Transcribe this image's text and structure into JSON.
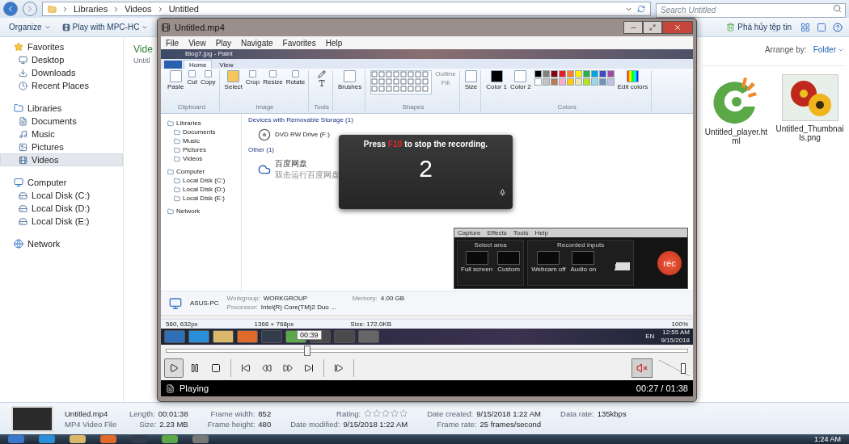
{
  "explorer": {
    "crumbs": [
      "Libraries",
      "Videos",
      "Untitled"
    ],
    "search": {
      "placeholder": "Search Untitled"
    },
    "toolbar": {
      "buttons": [
        "Organize",
        "Play with MPC-HC"
      ],
      "right_button": "Phá hủy tệp tin"
    },
    "sidebar": {
      "groups": [
        {
          "label": "Favorites",
          "children": [
            {
              "label": "Desktop",
              "selected": false
            },
            {
              "label": "Downloads",
              "selected": false
            },
            {
              "label": "Recent Places",
              "selected": false
            }
          ]
        },
        {
          "label": "Libraries",
          "children": [
            {
              "label": "Documents",
              "selected": false
            },
            {
              "label": "Music",
              "selected": false
            },
            {
              "label": "Pictures",
              "selected": false
            },
            {
              "label": "Videos",
              "selected": true
            }
          ]
        },
        {
          "label": "Computer",
          "children": [
            {
              "label": "Local Disk (C:)",
              "selected": false
            },
            {
              "label": "Local Disk (D:)",
              "selected": false
            },
            {
              "label": "Local Disk (E:)",
              "selected": false
            }
          ]
        },
        {
          "label": "Network"
        }
      ]
    },
    "heading": {
      "title": "Vide",
      "subtitle": "Untitl"
    },
    "arrange": {
      "label": "Arrange by:",
      "value": "Folder"
    },
    "files": [
      {
        "name": "Untitled_player.html",
        "kind": "web"
      },
      {
        "name": "Untitled_Thumbnails.png",
        "kind": "image"
      }
    ],
    "details": {
      "file_name": "Untitled.mp4",
      "file_type": "MP4 Video File",
      "stars": 0,
      "columns": [
        [
          {
            "kind": "text",
            "label": "Length:",
            "value": "00:01:38"
          },
          {
            "kind": "text",
            "label": "Size:",
            "value": "2.23 MB"
          }
        ],
        [
          {
            "kind": "text",
            "label": "Frame width:",
            "value": "852"
          },
          {
            "kind": "text",
            "label": "Frame height:",
            "value": "480"
          }
        ],
        [
          {
            "kind": "rating",
            "label": "Rating:"
          },
          {
            "kind": "text",
            "label": "Date modified:",
            "value": "9/15/2018 1:22 AM"
          }
        ],
        [
          {
            "kind": "text",
            "label": "Date created:",
            "value": "9/15/2018 1:22 AM"
          },
          {
            "kind": "text",
            "label": "Frame rate:",
            "value": "25 frames/second"
          }
        ],
        [
          {
            "kind": "text",
            "label": "Data rate:",
            "value": "135kbps"
          }
        ]
      ]
    }
  },
  "player": {
    "title": "Untitled.mp4",
    "menu": [
      "File",
      "View",
      "Play",
      "Navigate",
      "Favorites",
      "Help"
    ],
    "video": {
      "paint": {
        "title": "Blog7.jpg - Paint",
        "tabs": [
          {
            "label": "Home",
            "selected": true
          },
          {
            "label": "View",
            "selected": false
          }
        ],
        "groups": [
          {
            "kind": "buttons",
            "label": "Clipboard",
            "items": [
              "Paste",
              "Cut",
              "Copy"
            ]
          },
          {
            "kind": "buttons",
            "label": "Image",
            "items": [
              "Select",
              "Crop",
              "Resize",
              "Rotate"
            ]
          },
          {
            "kind": "tools",
            "label": "Tools"
          },
          {
            "kind": "buttons",
            "items": [
              "Brushes"
            ]
          },
          {
            "kind": "shapes",
            "label": "Shapes",
            "items": [
              "Outline",
              "Fill"
            ]
          },
          {
            "kind": "buttons",
            "items": [
              "Size"
            ]
          },
          {
            "kind": "colors",
            "label": "Colors",
            "items": [
              "Color 1",
              "Color 2",
              "Edit colors"
            ]
          }
        ],
        "palette": [
          {
            "color": "#000000"
          },
          {
            "color": "#7f7f7f"
          },
          {
            "color": "#880015"
          },
          {
            "color": "#ed1c24"
          },
          {
            "color": "#ff7f27"
          },
          {
            "color": "#fff200"
          },
          {
            "color": "#22b14c"
          },
          {
            "color": "#00a2e8"
          },
          {
            "color": "#3f48cc"
          },
          {
            "color": "#a349a4"
          },
          {
            "color": "#ffffff"
          },
          {
            "color": "#c3c3c3"
          },
          {
            "color": "#b97a57"
          },
          {
            "color": "#ffaec9"
          },
          {
            "color": "#ffc90e"
          },
          {
            "color": "#efe4b0"
          },
          {
            "color": "#b5e61d"
          },
          {
            "color": "#99d9ea"
          },
          {
            "color": "#7092be"
          },
          {
            "color": "#c8bfe7"
          }
        ]
      },
      "nav": [
        {
          "label": "Libraries",
          "children": [
            {
              "label": "Documents"
            },
            {
              "label": "Music"
            },
            {
              "label": "Pictures"
            },
            {
              "label": "Videos"
            }
          ]
        },
        {
          "label": "Computer",
          "children": [
            {
              "label": "Local Disk (C:)"
            },
            {
              "label": "Local Disk (D:)"
            },
            {
              "label": "Local Disk (E:)"
            }
          ]
        },
        {
          "label": "Network"
        }
      ],
      "sections": [
        {
          "title": "Devices with Removable Storage (1)",
          "items": [
            {
              "name": "DVD RW Drive (F:)"
            }
          ]
        },
        {
          "title": "Other (1)",
          "items": [
            {
              "name": "百度网盘",
              "subtitle": "双击运行百度网盘"
            }
          ]
        }
      ],
      "computer": {
        "name": "ASUS-PC",
        "fields": [
          {
            "label": "Workgroup:",
            "value": "WORKGROUP"
          },
          {
            "label": "Memory:",
            "value": "4.00 GB"
          },
          {
            "label": "Processor:",
            "value": "Intel(R) Core(TM)2 Duo ..."
          }
        ]
      },
      "status": [
        "560, 632px",
        "1366 × 768px",
        "Size: 172.0KB"
      ],
      "zoom": "100%",
      "overlay": {
        "before": "Press",
        "key": "F10",
        "after": "to stop the recording.",
        "count": "2"
      },
      "recorder": {
        "menu": [
          "Capture",
          "Effects",
          "Tools",
          "Help"
        ],
        "sections": [
          {
            "title": "Select area",
            "buttons": [
              "Full screen",
              "Custom"
            ]
          },
          {
            "title": "Recorded inputs",
            "buttons": [
              "Webcam off",
              "Audio on"
            ]
          }
        ],
        "rec": "rec"
      },
      "taskbar": {
        "language": "EN",
        "time": "12:55 AM",
        "date": "9/15/2018"
      },
      "tooltip": "00:39"
    },
    "seek": {
      "level": 0.27
    },
    "controls": [
      {
        "kind": "play",
        "selected": true
      },
      {
        "kind": "pause",
        "selected": false
      },
      {
        "kind": "stop",
        "selected": false
      },
      {
        "kind": "prev",
        "selected": false
      },
      {
        "kind": "rewind",
        "selected": false
      },
      {
        "kind": "forward",
        "selected": false
      },
      {
        "kind": "next",
        "selected": false
      },
      {
        "kind": "step",
        "selected": false
      }
    ],
    "muted": true,
    "volume": {
      "level": 0.8
    },
    "status": "Playing",
    "time": "00:27 / 01:38"
  },
  "taskbar": {
    "time": "1:24 AM"
  }
}
